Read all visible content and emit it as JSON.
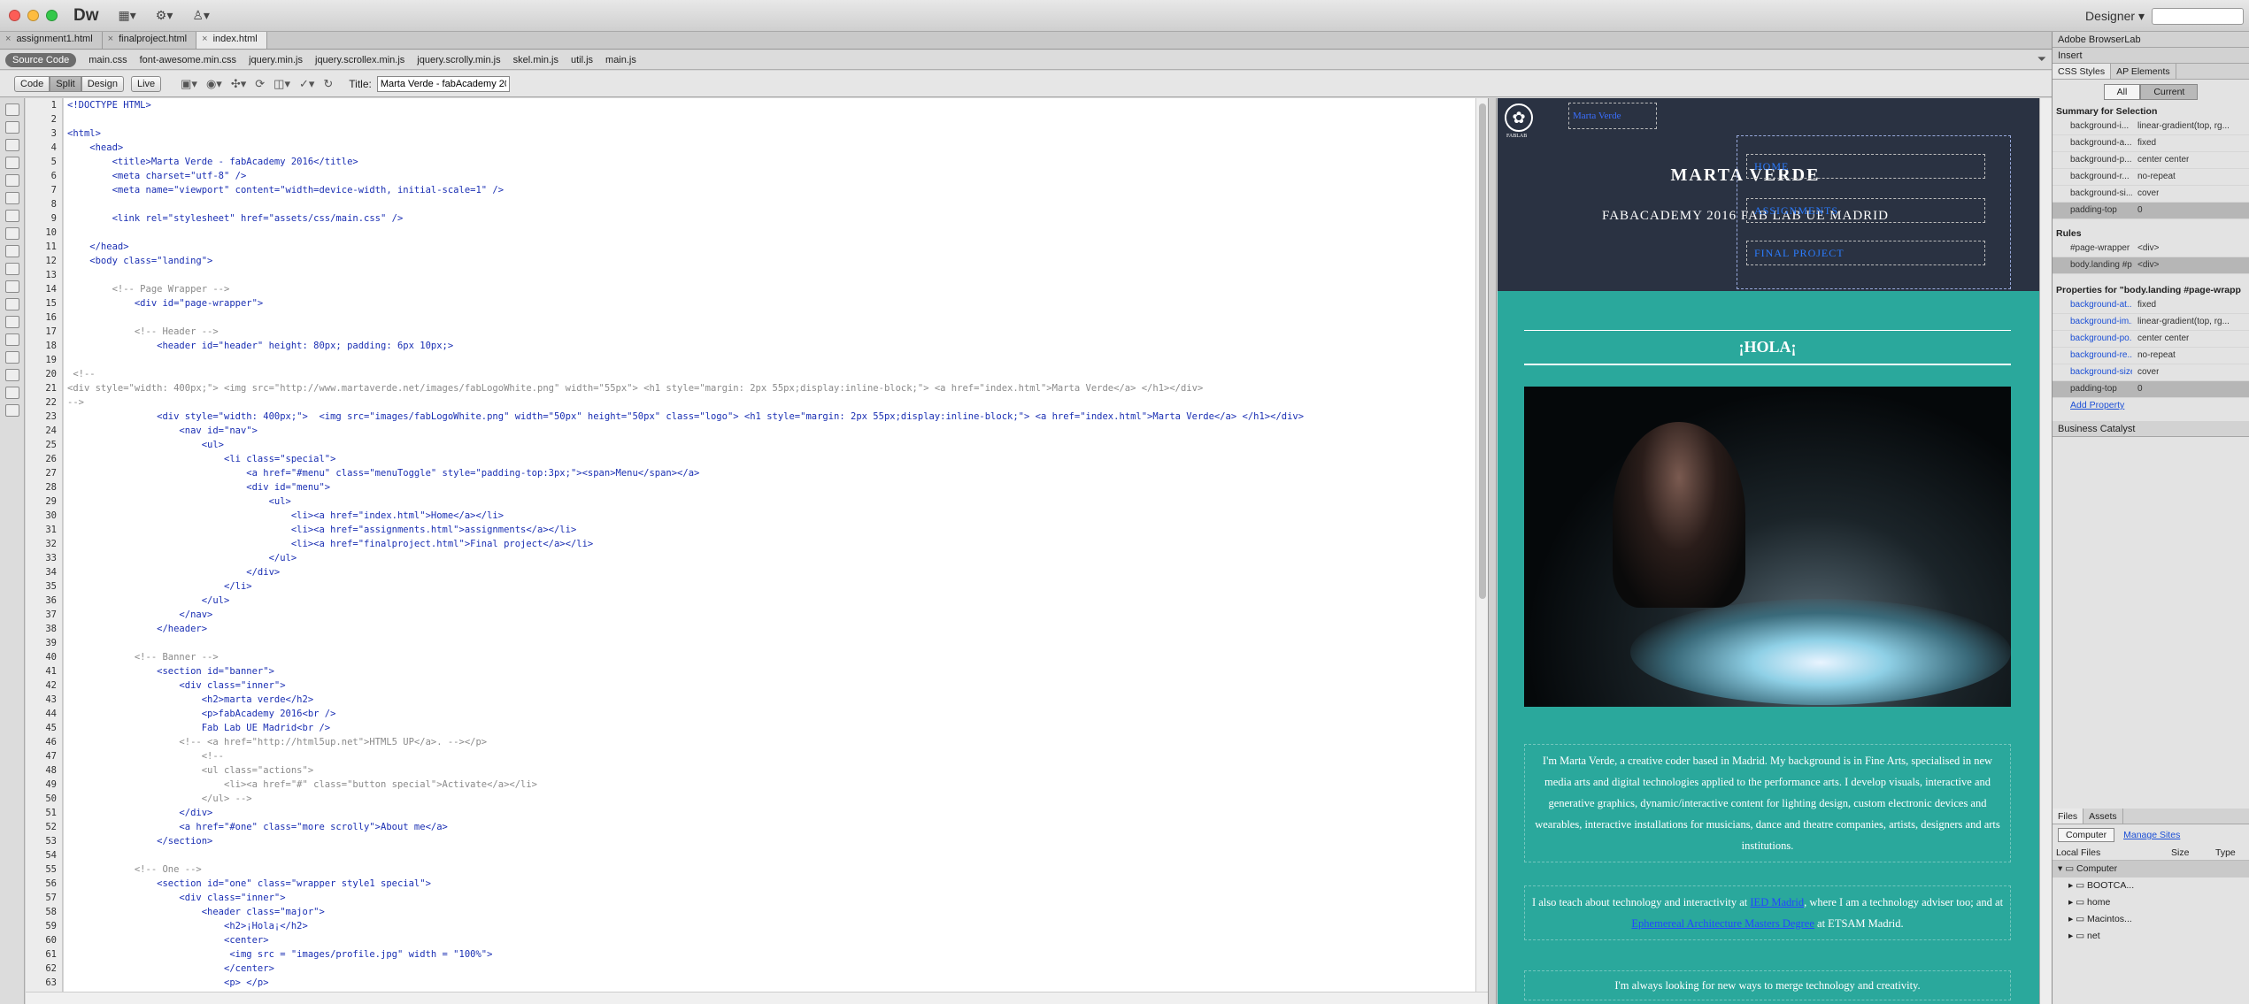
{
  "app": {
    "logo": "Dw",
    "workspace": "Designer ▾"
  },
  "doc_tabs": [
    {
      "label": "assignment1.html"
    },
    {
      "label": "finalproject.html"
    },
    {
      "label": "index.html"
    }
  ],
  "related_files": {
    "source_code": "Source Code",
    "files": [
      "main.css",
      "font-awesome.min.css",
      "jquery.min.js",
      "jquery.scrollex.min.js",
      "jquery.scrolly.min.js",
      "skel.min.js",
      "util.js",
      "main.js"
    ]
  },
  "doc_toolbar": {
    "code": "Code",
    "split": "Split",
    "design": "Design",
    "live": "Live",
    "title_label": "Title:",
    "title_value": "Marta Verde - fabAcademy 20"
  },
  "code_lines": [
    {
      "n": "1",
      "t": "<!DOCTYPE HTML>",
      "c": "tag"
    },
    {
      "n": "2",
      "t": "",
      "c": "txt"
    },
    {
      "n": "3",
      "t": "<html>",
      "c": "tag"
    },
    {
      "n": "4",
      "t": "    <head>",
      "c": "tag"
    },
    {
      "n": "5",
      "t": "        <title>Marta Verde - fabAcademy 2016</title>",
      "c": "tag"
    },
    {
      "n": "6",
      "t": "        <meta charset=\"utf-8\" />",
      "c": "tag"
    },
    {
      "n": "7",
      "t": "        <meta name=\"viewport\" content=\"width=device-width, initial-scale=1\" />",
      "c": "tag"
    },
    {
      "n": "8",
      "t": "",
      "c": "txt"
    },
    {
      "n": "9",
      "t": "        <link rel=\"stylesheet\" href=\"assets/css/main.css\" />",
      "c": "tag"
    },
    {
      "n": "10",
      "t": "",
      "c": "txt"
    },
    {
      "n": "11",
      "t": "    </head>",
      "c": "tag"
    },
    {
      "n": "12",
      "t": "    <body class=\"landing\">",
      "c": "tag"
    },
    {
      "n": "13",
      "t": "",
      "c": "txt"
    },
    {
      "n": "14",
      "t": "        <!-- Page Wrapper -->",
      "c": "cmt"
    },
    {
      "n": "15",
      "t": "            <div id=\"page-wrapper\">",
      "c": "tag"
    },
    {
      "n": "16",
      "t": "",
      "c": "txt"
    },
    {
      "n": "17",
      "t": "            <!-- Header -->",
      "c": "cmt"
    },
    {
      "n": "18",
      "t": "                <header id=\"header\" height: 80px; padding: 6px 10px;>",
      "c": "tag"
    },
    {
      "n": "19",
      "t": "",
      "c": "txt"
    },
    {
      "n": "20",
      "t": " <!--",
      "c": "cmt"
    },
    {
      "n": "21",
      "t": "<div style=\"width: 400px;\"> <img src=\"http://www.martaverde.net/images/fabLogoWhite.png\" width=\"55px\"> <h1 style=\"margin: 2px 55px;display:inline-block;\"> <a href=\"index.html\">Marta Verde</a> </h1></div>",
      "c": "cmt"
    },
    {
      "n": "22",
      "t": "-->",
      "c": "cmt"
    },
    {
      "n": "23",
      "t": "                <div style=\"width: 400px;\">  <img src=\"images/fabLogoWhite.png\" width=\"50px\" height=\"50px\" class=\"logo\"> <h1 style=\"margin: 2px 55px;display:inline-block;\"> <a href=\"index.html\">Marta Verde</a> </h1></div>",
      "c": "tag"
    },
    {
      "n": "24",
      "t": "                    <nav id=\"nav\">",
      "c": "tag"
    },
    {
      "n": "25",
      "t": "                        <ul>",
      "c": "tag"
    },
    {
      "n": "26",
      "t": "                            <li class=\"special\">",
      "c": "tag"
    },
    {
      "n": "27",
      "t": "                                <a href=\"#menu\" class=\"menuToggle\" style=\"padding-top:3px;\"><span>Menu</span></a>",
      "c": "tag"
    },
    {
      "n": "28",
      "t": "                                <div id=\"menu\">",
      "c": "tag"
    },
    {
      "n": "29",
      "t": "                                    <ul>",
      "c": "tag"
    },
    {
      "n": "30",
      "t": "                                        <li><a href=\"index.html\">Home</a></li>",
      "c": "tag"
    },
    {
      "n": "31",
      "t": "                                        <li><a href=\"assignments.html\">assignments</a></li>",
      "c": "tag"
    },
    {
      "n": "32",
      "t": "                                        <li><a href=\"finalproject.html\">Final project</a></li>",
      "c": "tag"
    },
    {
      "n": "33",
      "t": "                                    </ul>",
      "c": "tag"
    },
    {
      "n": "34",
      "t": "                                </div>",
      "c": "tag"
    },
    {
      "n": "35",
      "t": "                            </li>",
      "c": "tag"
    },
    {
      "n": "36",
      "t": "                        </ul>",
      "c": "tag"
    },
    {
      "n": "37",
      "t": "                    </nav>",
      "c": "tag"
    },
    {
      "n": "38",
      "t": "                </header>",
      "c": "tag"
    },
    {
      "n": "39",
      "t": "",
      "c": "txt"
    },
    {
      "n": "40",
      "t": "            <!-- Banner -->",
      "c": "cmt"
    },
    {
      "n": "41",
      "t": "                <section id=\"banner\">",
      "c": "tag"
    },
    {
      "n": "42",
      "t": "                    <div class=\"inner\">",
      "c": "tag"
    },
    {
      "n": "43",
      "t": "                        <h2>marta verde</h2>",
      "c": "tag"
    },
    {
      "n": "44",
      "t": "                        <p>fabAcademy 2016<br />",
      "c": "tag"
    },
    {
      "n": "45",
      "t": "                        Fab Lab UE Madrid<br />",
      "c": "tag"
    },
    {
      "n": "46",
      "t": "                    <!-- <a href=\"http://html5up.net\">HTML5 UP</a>. --></p>",
      "c": "cmt"
    },
    {
      "n": "47",
      "t": "                        <!--",
      "c": "cmt"
    },
    {
      "n": "48",
      "t": "                        <ul class=\"actions\">",
      "c": "cmt"
    },
    {
      "n": "49",
      "t": "                            <li><a href=\"#\" class=\"button special\">Activate</a></li>",
      "c": "cmt"
    },
    {
      "n": "50",
      "t": "                        </ul> -->",
      "c": "cmt"
    },
    {
      "n": "51",
      "t": "                    </div>",
      "c": "tag"
    },
    {
      "n": "52",
      "t": "                    <a href=\"#one\" class=\"more scrolly\">About me</a>",
      "c": "tag"
    },
    {
      "n": "53",
      "t": "                </section>",
      "c": "tag"
    },
    {
      "n": "54",
      "t": "",
      "c": "txt"
    },
    {
      "n": "55",
      "t": "            <!-- One -->",
      "c": "cmt"
    },
    {
      "n": "56",
      "t": "                <section id=\"one\" class=\"wrapper style1 special\">",
      "c": "tag"
    },
    {
      "n": "57",
      "t": "                    <div class=\"inner\">",
      "c": "tag"
    },
    {
      "n": "58",
      "t": "                        <header class=\"major\">",
      "c": "tag"
    },
    {
      "n": "59",
      "t": "                            <h2>¡Hola¡</h2>",
      "c": "tag"
    },
    {
      "n": "60",
      "t": "                            <center>",
      "c": "tag"
    },
    {
      "n": "61",
      "t": "                             <img src = \"images/profile.jpg\" width = \"100%\">",
      "c": "tag"
    },
    {
      "n": "62",
      "t": "                            </center>",
      "c": "tag"
    },
    {
      "n": "63",
      "t": "                            <p> </p>",
      "c": "tag"
    }
  ],
  "design_view": {
    "home_link": "Marta Verde",
    "logo_text": "FABLAB",
    "site_title": "MARTA VERDE",
    "subtitle": "FABACADEMY 2016 FAB LAB UE MADRID",
    "menu": [
      "HOME",
      "ASSIGNMENTS",
      "FINAL PROJECT"
    ],
    "hola": "¡HOLA¡",
    "para1": "I'm Marta Verde, a creative coder based in Madrid. My background is in Fine Arts, specialised in new media arts and digital technologies applied to the performance arts. I develop visuals, interactive and generative graphics, dynamic/interactive content for lighting design, custom electronic devices and wearables, interactive installations for musicians, dance and theatre companies, artists, designers and arts institutions.",
    "para2_a": "I also teach about technology and interactivity at ",
    "para2_link1": "IED Madrid",
    "para2_b": ", where I am a technology adviser too; and at ",
    "para2_link2": "Ephemereal Architecture Masters Degree",
    "para2_c": " at ETSAM Madrid.",
    "para3": "I'm always looking for new ways to merge technology and creativity."
  },
  "panel": {
    "browserlab": "Adobe BrowserLab",
    "insert": "Insert",
    "tabs": [
      "CSS Styles",
      "AP Elements"
    ],
    "seg": [
      "All",
      "Current"
    ],
    "summary_title": "Summary for Selection",
    "summary": [
      {
        "k": "background-i...",
        "v": "linear-gradient(top, rg..."
      },
      {
        "k": "background-a...",
        "v": "fixed"
      },
      {
        "k": "background-p...",
        "v": "center center"
      },
      {
        "k": "background-r...",
        "v": "no-repeat"
      },
      {
        "k": "background-si...",
        "v": "cover"
      },
      {
        "k": "padding-top",
        "v": "0"
      }
    ],
    "rules_title": "Rules",
    "rules": [
      {
        "k": "#page-wrapper",
        "v": "<div>"
      },
      {
        "k": "body.landing #page-w...",
        "v": "<div>"
      }
    ],
    "props_title": "Properties for \"body.landing #page-wrapp",
    "props": [
      {
        "k": "background-at...",
        "v": "fixed"
      },
      {
        "k": "background-im...",
        "v": "linear-gradient(top, rg..."
      },
      {
        "k": "background-po...",
        "v": "center center"
      },
      {
        "k": "background-re...",
        "v": "no-repeat"
      },
      {
        "k": "background-size",
        "v": "cover"
      },
      {
        "k": "padding-top",
        "v": "0"
      }
    ],
    "add_property": "Add Property",
    "business_catalyst": "Business Catalyst",
    "files_tabs": [
      "Files",
      "Assets"
    ],
    "site_select": "Computer",
    "manage_sites": "Manage Sites",
    "local_files": "Local Files",
    "size": "Size",
    "type": "Type",
    "tree": [
      "Computer",
      "BOOTCA...",
      "home",
      "Macintos...",
      "net"
    ]
  }
}
